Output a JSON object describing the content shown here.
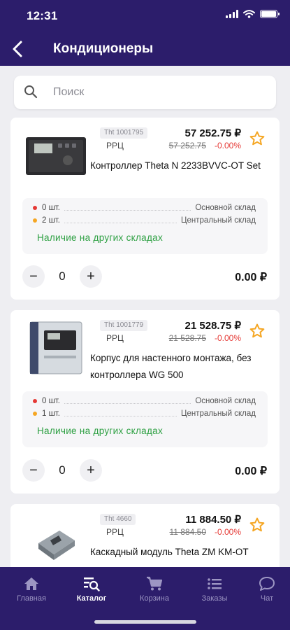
{
  "status": {
    "time": "12:31"
  },
  "header": {
    "title": "Кондиционеры"
  },
  "search": {
    "placeholder": "Поиск"
  },
  "products": [
    {
      "code": "Tht 1001795",
      "price_label": "РРЦ",
      "price": "57 252.75 ₽",
      "old_price": "57 252.75",
      "discount": "-0.00%",
      "name": "Контроллер Theta N 2233BVVC-OT Set",
      "stock": [
        {
          "qty": "0 шт.",
          "warehouse": "Основной склад",
          "color": "#e53935"
        },
        {
          "qty": "2 шт.",
          "warehouse": "Центральный склад",
          "color": "#f5a623"
        }
      ],
      "other_stores": "Наличие на других складах",
      "quantity": "0",
      "total": "0.00 ₽"
    },
    {
      "code": "Tht 1001779",
      "price_label": "РРЦ",
      "price": "21 528.75 ₽",
      "old_price": "21 528.75",
      "discount": "-0.00%",
      "name": "Корпус для настенного монтажа, без контроллера WG 500",
      "stock": [
        {
          "qty": "0 шт.",
          "warehouse": "Основной склад",
          "color": "#e53935"
        },
        {
          "qty": "1 шт.",
          "warehouse": "Центральный склад",
          "color": "#f5a623"
        }
      ],
      "other_stores": "Наличие на других складах",
      "quantity": "0",
      "total": "0.00 ₽"
    },
    {
      "code": "Tht 4660",
      "price_label": "РРЦ",
      "price": "11 884.50 ₽",
      "old_price": "11 884.50",
      "discount": "-0.00%",
      "name": "Каскадный модуль Theta ZM KM-OT"
    }
  ],
  "tabs": [
    {
      "label": "Главная",
      "icon": "home-icon"
    },
    {
      "label": "Каталог",
      "icon": "catalog-search-icon",
      "active": true
    },
    {
      "label": "Корзина",
      "icon": "cart-icon"
    },
    {
      "label": "Заказы",
      "icon": "orders-list-icon"
    },
    {
      "label": "Чат",
      "icon": "chat-icon"
    }
  ],
  "colors": {
    "primary": "#2c1d6b",
    "price_red": "#e53935",
    "stock_green": "#2ea043",
    "star": "#f5a623"
  }
}
